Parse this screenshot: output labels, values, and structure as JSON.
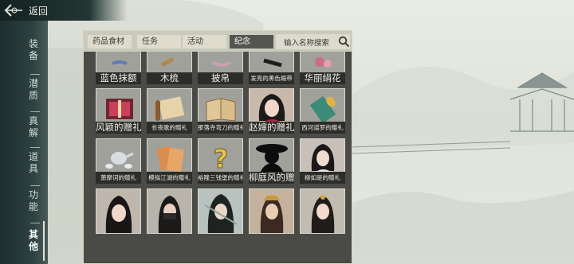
{
  "header": {
    "back_label": "返回"
  },
  "sidebar": {
    "categories": [
      {
        "label": "装备"
      },
      {
        "label": "潜质"
      },
      {
        "label": "真解"
      },
      {
        "label": "道具"
      },
      {
        "label": "功能"
      },
      {
        "label": "其他",
        "active": true
      }
    ]
  },
  "tabs": [
    {
      "label": "药品食材"
    },
    {
      "label": "任务"
    },
    {
      "label": "活动"
    },
    {
      "label": "纪念",
      "active": true
    }
  ],
  "search": {
    "placeholder": "输入名称搜索"
  },
  "items": [
    {
      "name": "蓝色抹额",
      "icon": "blue-headband-icon"
    },
    {
      "name": "木梳",
      "icon": "wooden-comb-icon"
    },
    {
      "name": "披帛",
      "icon": "silk-shawl-icon"
    },
    {
      "name": "发亮的黑色缎带",
      "icon": "black-ribbon-icon"
    },
    {
      "name": "华丽绢花",
      "icon": "silk-flower-icon"
    },
    {
      "name": "风颖的赠礼",
      "icon": "gift-box-icon"
    },
    {
      "name": "长夜歌的赠礼",
      "icon": "scroll-icon"
    },
    {
      "name": "那落寺弯刀的赠礼",
      "icon": "open-book-icon"
    },
    {
      "name": "赵婶的赠礼",
      "icon": "woman-portrait-icon"
    },
    {
      "name": "西河谣罗的赠礼",
      "icon": "silk-roll-icon"
    },
    {
      "name": "萧摩诃的赠礼",
      "icon": "tea-set-icon"
    },
    {
      "name": "模拟江湖的赠礼",
      "icon": "papers-icon"
    },
    {
      "name": "裕隆三钱堡的赠礼",
      "icon": "question-mark-icon"
    },
    {
      "name": "柳庭风的赠礼",
      "icon": "silhouette-icon"
    },
    {
      "name": "柳如是的赠礼",
      "icon": "woman-portrait-icon"
    },
    {
      "name": "",
      "icon": "woman-portrait-icon"
    },
    {
      "name": "",
      "icon": "masked-man-portrait-icon"
    },
    {
      "name": "",
      "icon": "swordsman-portrait-icon"
    },
    {
      "name": "",
      "icon": "warrior-portrait-icon"
    },
    {
      "name": "",
      "icon": "lady-portrait-icon"
    }
  ]
}
